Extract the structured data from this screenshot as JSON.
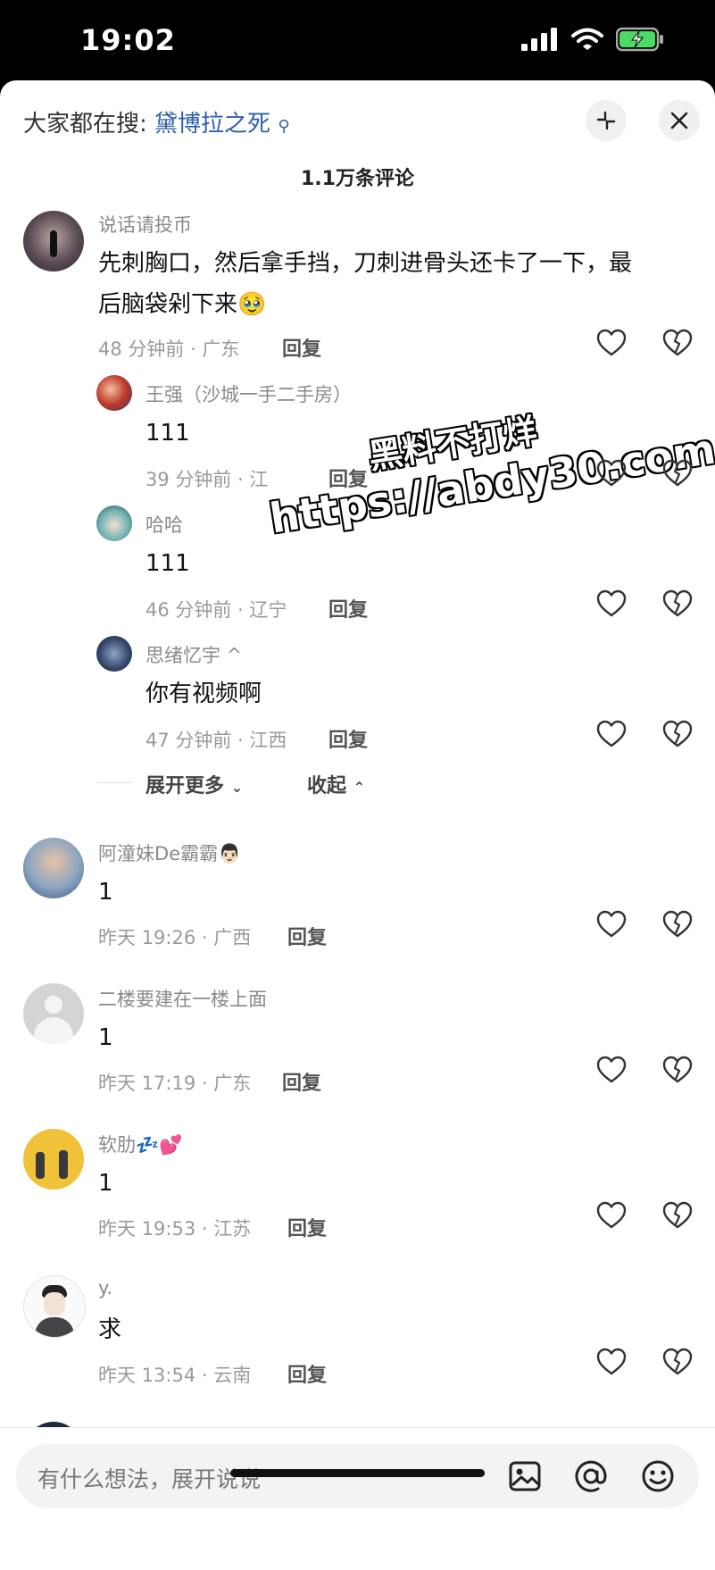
{
  "status_bar": {
    "time": "19:02"
  },
  "header": {
    "search_prefix": "大家都在搜:",
    "search_keyword": "黛博拉之死",
    "comment_count": "1.1万条评论"
  },
  "comments": [
    {
      "username": "说话请投币",
      "text_line1": "先刺胸口，然后拿手挡，刀刺进骨头还卡了一下，最",
      "text_line2": "后脑袋剁下来",
      "emoji": "🥹",
      "meta": "48 分钟前 · 广东",
      "reply_label": "回复",
      "replies": [
        {
          "username": "王强（沙城一手二手房）",
          "text": "111",
          "meta": "39 分钟前 · 江",
          "reply_label": "回复"
        },
        {
          "username": "哈哈",
          "text": "111",
          "meta": "46 分钟前 · 辽宁",
          "reply_label": "回复"
        },
        {
          "username": "思绪忆宇 ^",
          "text": "你有视频啊",
          "meta": "47 分钟前 · 江西",
          "reply_label": "回复"
        }
      ]
    },
    {
      "username": "阿潼妹De霸霸",
      "emoji": "👨🏻",
      "text": "1",
      "meta": "昨天 19:26 · 广西",
      "reply_label": "回复"
    },
    {
      "username": "二楼要建在一楼上面",
      "text": "1",
      "meta": "昨天 17:19 · 广东",
      "reply_label": "回复"
    },
    {
      "username": "软肋",
      "emoji": "💤💕",
      "text": "1",
      "meta": "昨天 19:53 · 江苏",
      "reply_label": "回复"
    },
    {
      "username": "y.",
      "text": "求",
      "meta": "昨天 13:54 · 云南",
      "reply_label": "回复"
    }
  ],
  "expand": {
    "more": "展开更多",
    "collapse": "收起"
  },
  "watermark": {
    "line1": "黑料不打烊",
    "line2": "https://abdy30.com"
  },
  "input": {
    "placeholder": "有什么想法，展开说说"
  },
  "icons": [
    "signal-icon",
    "wifi-icon",
    "battery-icon",
    "collapse-icon",
    "close-icon",
    "heart-icon",
    "dislike-icon",
    "image-icon",
    "at-icon",
    "emoji-icon"
  ]
}
